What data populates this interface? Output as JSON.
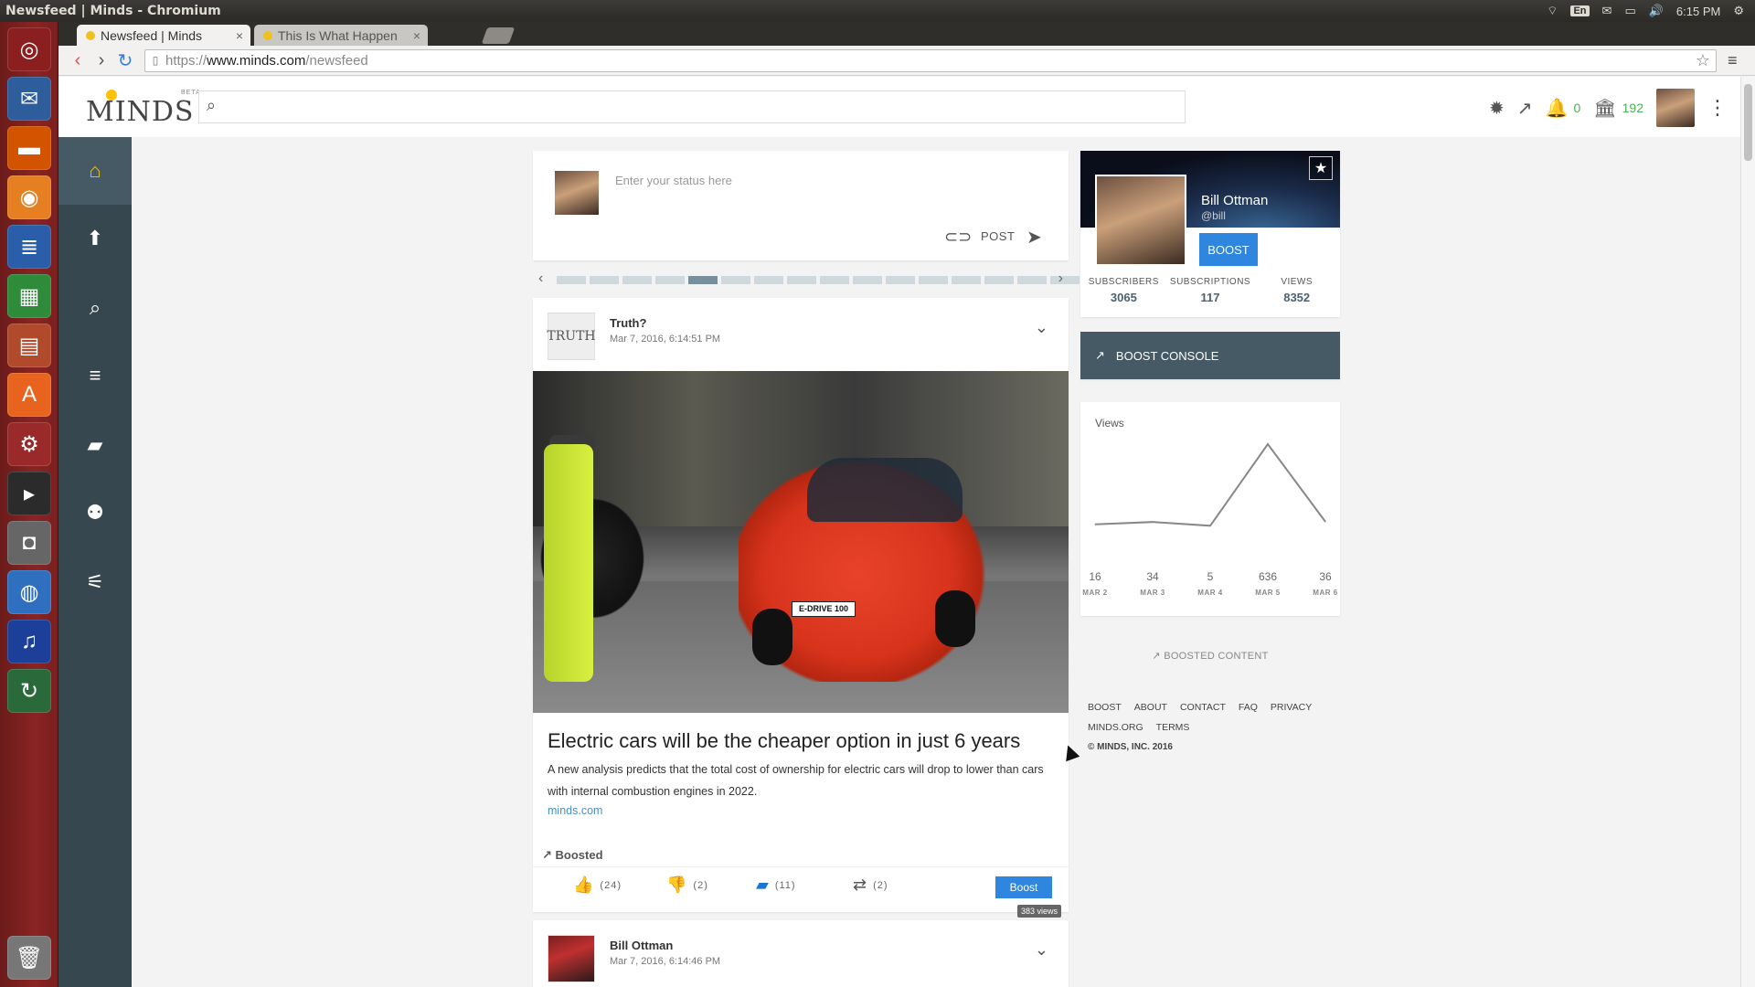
{
  "os": {
    "window_title": "Newsfeed | Minds - Chromium",
    "lang": "En",
    "time": "6:15 PM"
  },
  "browser": {
    "tabs": [
      {
        "label": "Newsfeed | Minds",
        "close": "×"
      },
      {
        "label": "This Is What Happen",
        "close": "×"
      }
    ],
    "url_scheme": "https://",
    "url_host": "www.minds.com",
    "url_path": "/newsfeed"
  },
  "minds": {
    "logo": "MINDS",
    "beta": "BETA",
    "search_placeholder": "",
    "notifications_count": "0",
    "wallet_count": "192"
  },
  "composer": {
    "placeholder": "Enter your status here",
    "post_label": "POST"
  },
  "carousel": {
    "segments": 16,
    "active_index": 4
  },
  "post1": {
    "author": "Truth?",
    "avatar_text": "TRUTH",
    "date": "Mar 7, 2016, 6:14:51 PM",
    "plate": "E-DRIVE 100",
    "title": "Electric cars will be the cheaper option in just 6 years",
    "description": "A new analysis predicts that the total cost of ownership for electric cars will drop to lower than cars with internal combustion engines in 2022.",
    "link": "minds.com",
    "boosted_label": "Boosted",
    "likes": "(24)",
    "dislikes": "(2)",
    "comments": "(11)",
    "reminds": "(2)",
    "boost_label": "Boost",
    "views_tag": "383 views"
  },
  "post2": {
    "author": "Bill Ottman",
    "date": "Mar 7, 2016, 6:14:46 PM"
  },
  "profile": {
    "name": "Bill Ottman",
    "handle": "@bill",
    "boost_label": "BOOST",
    "stats": [
      {
        "label": "SUBSCRIBERS",
        "value": "3065"
      },
      {
        "label": "SUBSCRIPTIONS",
        "value": "117"
      },
      {
        "label": "VIEWS",
        "value": "8352"
      }
    ]
  },
  "boost_console": {
    "label": "BOOST CONSOLE"
  },
  "views_chart": {
    "title": "Views",
    "points": [
      {
        "value": "16",
        "date": "MAR 2"
      },
      {
        "value": "34",
        "date": "MAR 3"
      },
      {
        "value": "5",
        "date": "MAR 4"
      },
      {
        "value": "636",
        "date": "MAR 5"
      },
      {
        "value": "36",
        "date": "MAR 6"
      }
    ]
  },
  "chart_data": {
    "type": "line",
    "title": "Views",
    "categories": [
      "MAR 2",
      "MAR 3",
      "MAR 4",
      "MAR 5",
      "MAR 6"
    ],
    "values": [
      16,
      34,
      5,
      636,
      36
    ]
  },
  "boosted_content_label": "BOOSTED CONTENT",
  "footer": {
    "row1": [
      "BOOST",
      "ABOUT",
      "CONTACT",
      "FAQ",
      "PRIVACY"
    ],
    "row2": [
      "MINDS.ORG",
      "TERMS"
    ],
    "copyright": "© MINDS, INC. 2016"
  },
  "colors": {
    "accent": "#2e86de",
    "nav": "#37474f",
    "nav_active_icon": "#ffc107",
    "console": "#455a64"
  }
}
